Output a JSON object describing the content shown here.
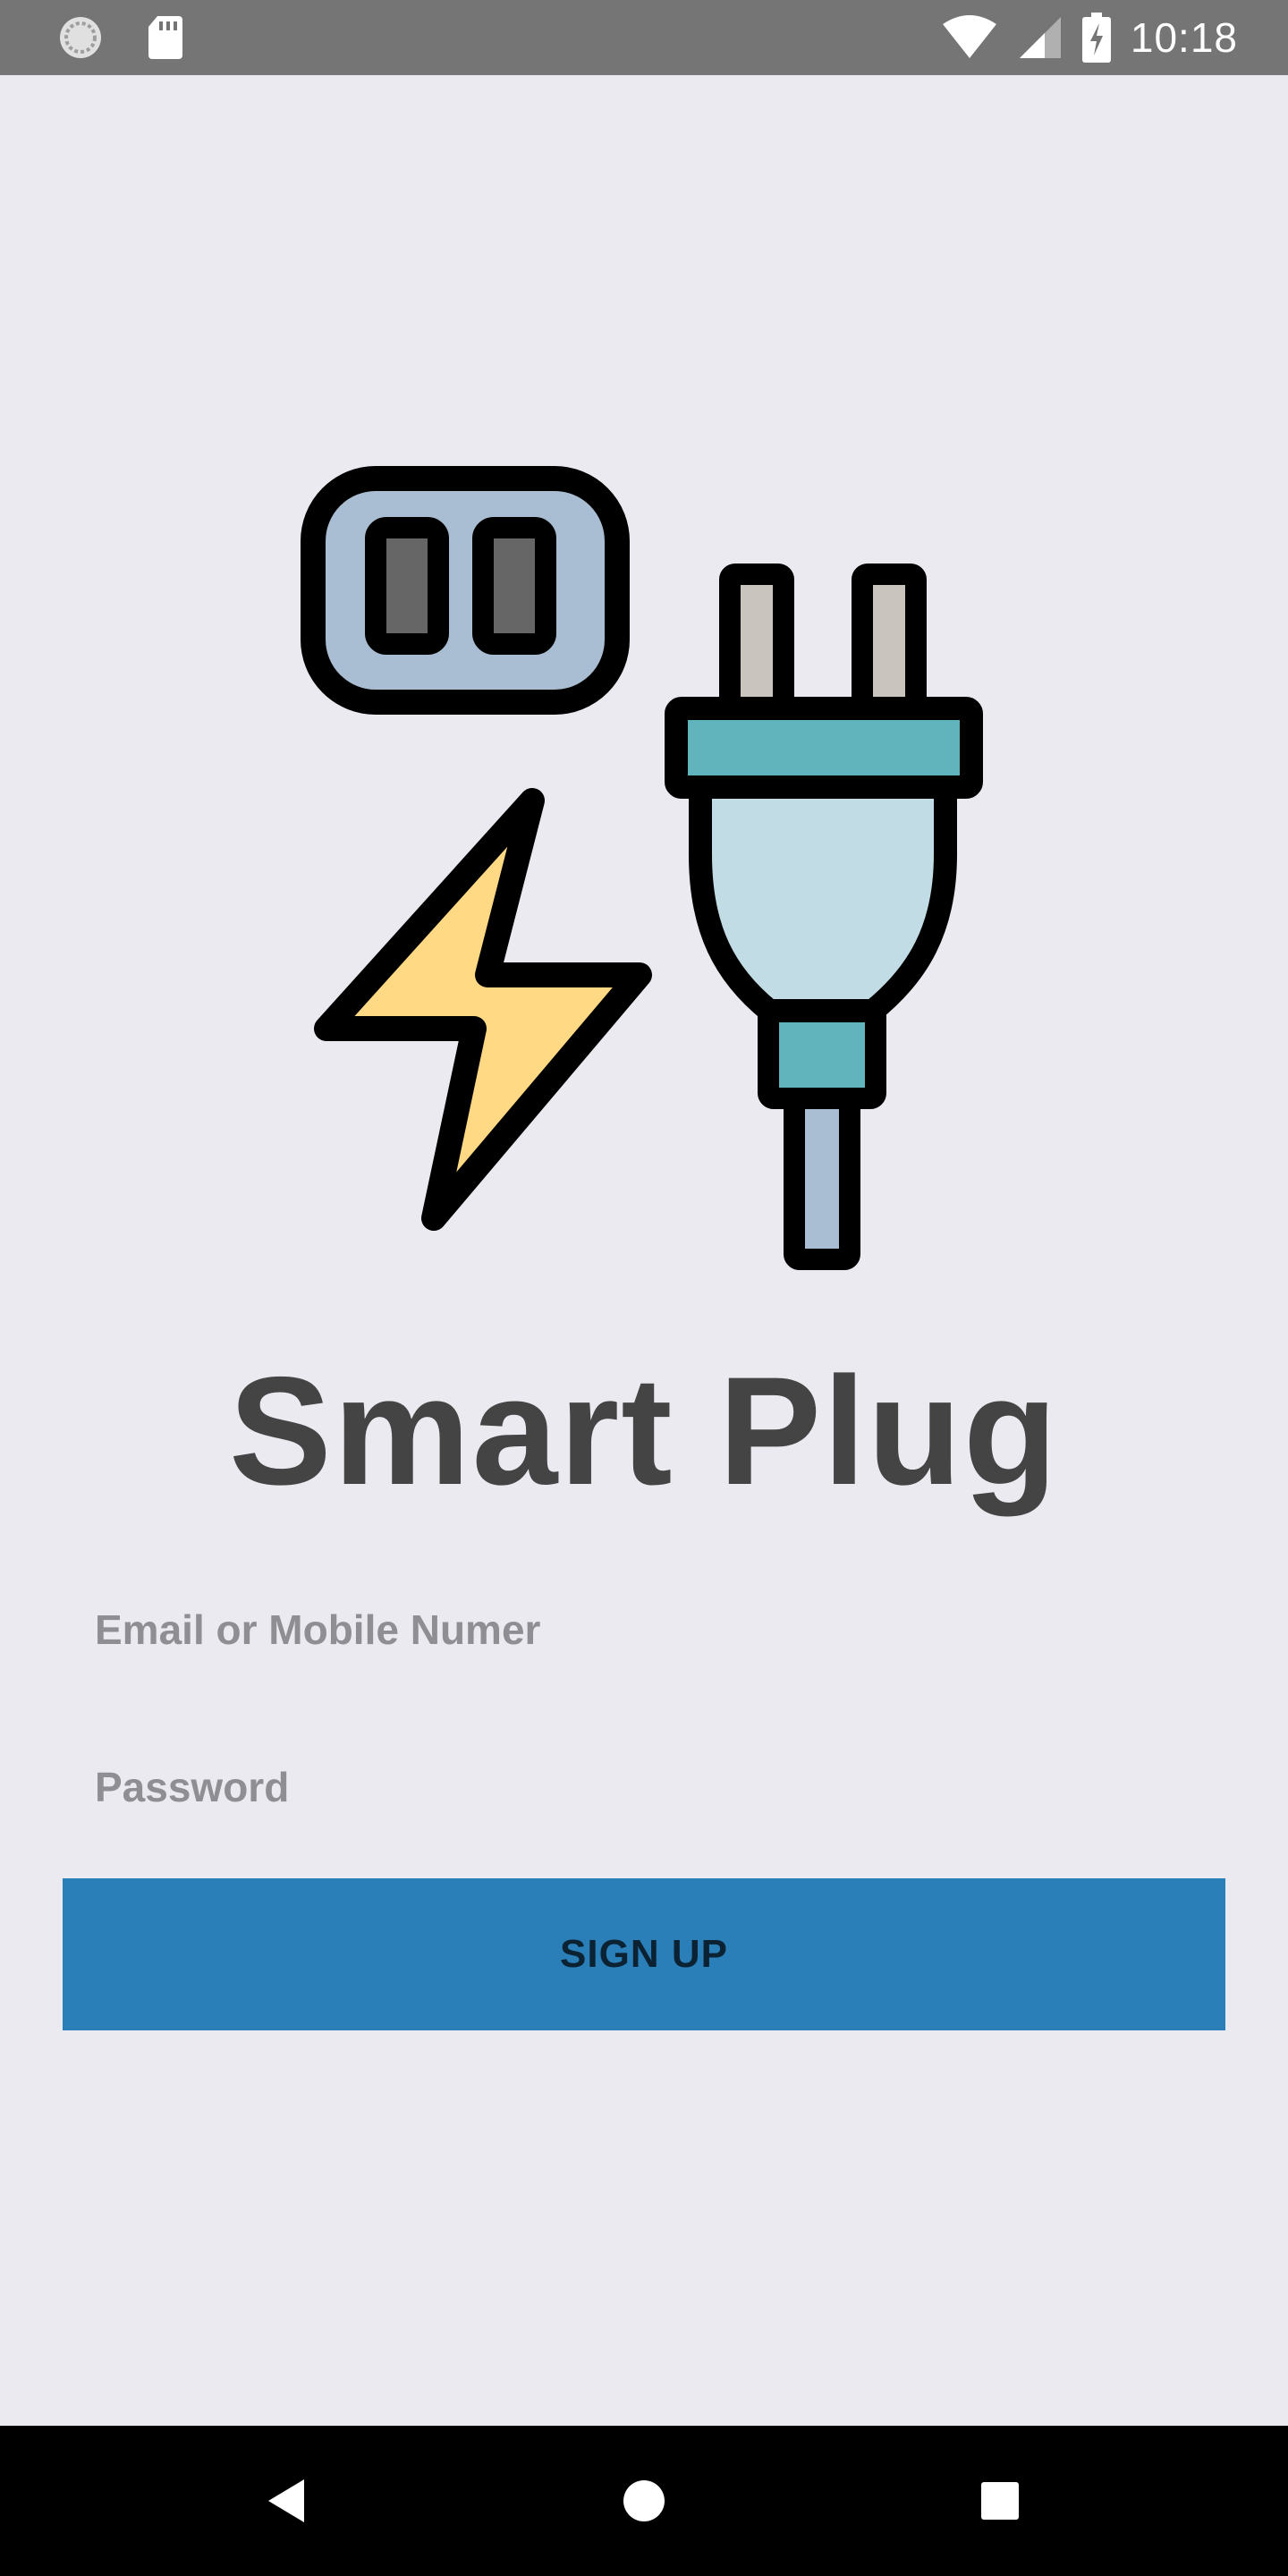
{
  "status_bar": {
    "time": "10:18",
    "left_icons": [
      "sync-icon",
      "sd-card-icon"
    ],
    "right_icons": [
      "wifi-icon",
      "cell-signal-icon",
      "battery-charging-icon"
    ]
  },
  "logo": {
    "icons": [
      "power-outlet-icon",
      "lightning-bolt-icon",
      "electric-plug-icon"
    ],
    "colors": {
      "outline": "#000000",
      "outlet_fill": "#A9BDD3",
      "outlet_slots": "#666666",
      "bolt_fill": "#FFD983",
      "prongs": "#C9C4BE",
      "plug_band": "#61B4BB",
      "plug_body": "#C2DCE5"
    }
  },
  "app": {
    "title": "Smart Plug"
  },
  "form": {
    "email_placeholder": "Email or Mobile Numer",
    "password_placeholder": "Password",
    "signup_label": "SIGN UP"
  },
  "theme": {
    "background": "#EBEAF0",
    "status_bar": "#757575",
    "button": "#2A7FB8",
    "title_color": "#444444",
    "nav_bar": "#000000"
  },
  "nav_bar": {
    "buttons": [
      "back-icon",
      "home-icon",
      "recents-icon"
    ]
  }
}
